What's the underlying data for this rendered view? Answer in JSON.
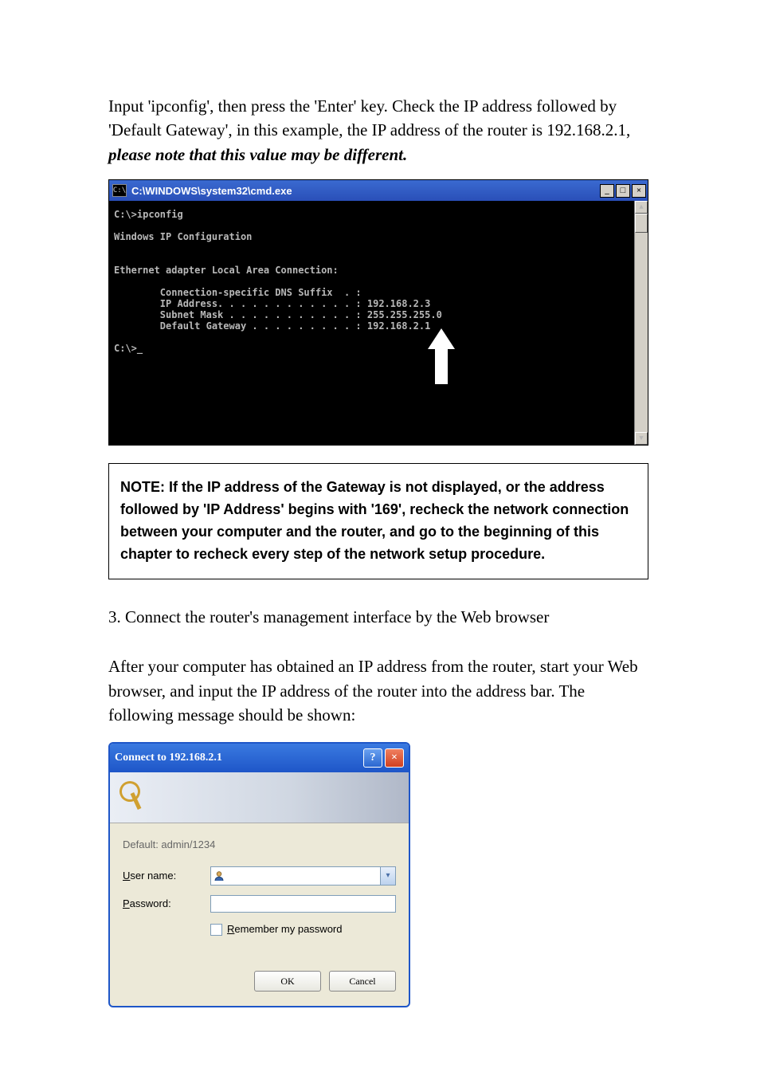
{
  "intro": {
    "p1_a": "Input 'ipconfig', then press the 'Enter' key. Check the IP address followed by 'Default Gateway', in this example, the IP address of the router is 192.168.2.1, ",
    "p1_b": "please note that this value may be different."
  },
  "cmd": {
    "icon_text": "C:\\",
    "title": "C:\\WINDOWS\\system32\\cmd.exe",
    "btn_min": "_",
    "btn_max": "□",
    "btn_close": "×",
    "scroll_up": "▲",
    "scroll_down": "▼",
    "output": "C:\\>ipconfig\n\nWindows IP Configuration\n\n\nEthernet adapter Local Area Connection:\n\n        Connection-specific DNS Suffix  . :\n        IP Address. . . . . . . . . . . . : 192.168.2.3\n        Subnet Mask . . . . . . . . . . . : 255.255.255.0\n        Default Gateway . . . . . . . . . : 192.168.2.1\n\nC:\\>_"
  },
  "note": "NOTE: If the IP address of the Gateway is not displayed, or the address followed by 'IP Address' begins with '169', recheck the network connection between your computer and the router, and go to the beginning of this chapter to recheck every step of the network setup procedure.",
  "step3": "3. Connect the router's management interface by the Web browser",
  "after": "After your computer has obtained an IP address from the router, start your Web browser, and input the IP address of the router into the address bar. The following message should be shown:",
  "dialog": {
    "title": "Connect to 192.168.2.1",
    "help": "?",
    "close": "×",
    "hint": "Default: admin/1234",
    "username_label_u": "U",
    "username_label_rest": "ser name:",
    "username_value": "",
    "password_label_u": "P",
    "password_label_rest": "assword:",
    "password_value": "",
    "remember_u": "R",
    "remember_rest": "emember my password",
    "ok": "OK",
    "cancel": "Cancel",
    "combo_arrow": "▾"
  }
}
